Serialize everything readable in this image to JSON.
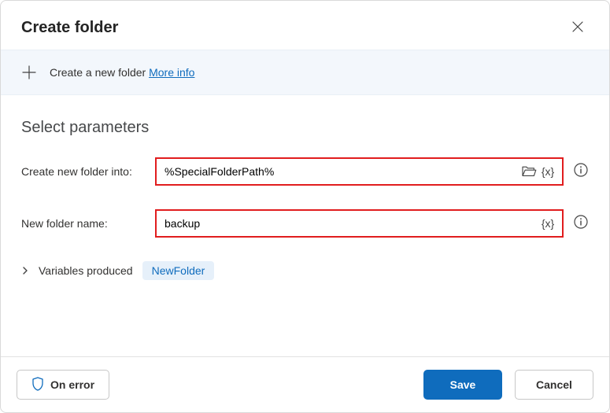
{
  "header": {
    "title": "Create folder"
  },
  "hint": {
    "text": "Create a new folder ",
    "link": "More info"
  },
  "section": {
    "title": "Select parameters"
  },
  "fields": {
    "into": {
      "label": "Create new folder into:",
      "value": "%SpecialFolderPath%"
    },
    "name": {
      "label": "New folder name:",
      "value": "backup"
    }
  },
  "variables": {
    "label": "Variables produced",
    "chip": "NewFolder"
  },
  "footer": {
    "onerror": "On error",
    "save": "Save",
    "cancel": "Cancel"
  }
}
